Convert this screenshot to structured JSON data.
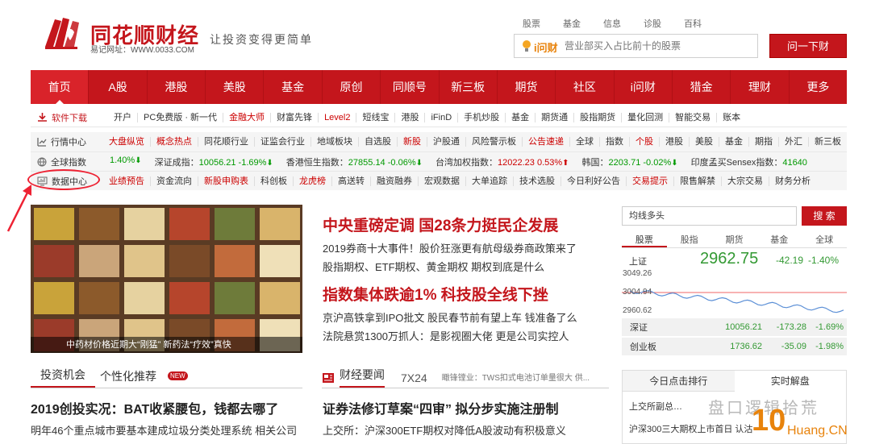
{
  "header": {
    "logo_text": "同花顺财经",
    "logo_url": "易记网址：WWW.0033.COM",
    "slogan": "让投资变得更简单",
    "search_tabs": [
      "股票",
      "基金",
      "信息",
      "诊股",
      "百科"
    ],
    "search_brand": "i问财",
    "search_placeholder": "营业部买入占比前十的股票",
    "ask_button": "问一下财"
  },
  "main_nav": [
    "首页",
    "A股",
    "港股",
    "美股",
    "基金",
    "原创",
    "同顺号",
    "新三板",
    "期货",
    "社区",
    "i问财",
    "猎金",
    "理财",
    "更多"
  ],
  "software_row": {
    "label": "软件下载",
    "items": [
      {
        "t": "开户",
        "hot": false
      },
      {
        "t": "PC免费版 · 新一代",
        "hot": false
      },
      {
        "t": "金融大师",
        "hot": true
      },
      {
        "t": "财富先锋",
        "hot": false
      },
      {
        "t": "Level2",
        "hot": true
      },
      {
        "t": "短线宝",
        "hot": false
      },
      {
        "t": "港股",
        "hot": false
      },
      {
        "t": "iFinD",
        "hot": false
      },
      {
        "t": "手机炒股",
        "hot": false
      },
      {
        "t": "基金",
        "hot": false
      },
      {
        "t": "期货通",
        "hot": false
      },
      {
        "t": "股指期货",
        "hot": false
      },
      {
        "t": "量化回测",
        "hot": false
      },
      {
        "t": "智能交易",
        "hot": false
      },
      {
        "t": "账本",
        "hot": false
      }
    ]
  },
  "news_row": {
    "label": "行情中心",
    "items": [
      {
        "t": "大盘纵览",
        "hot": true
      },
      {
        "t": "概念热点",
        "hot": true
      },
      {
        "t": "同花顺行业",
        "hot": false
      },
      {
        "t": "证监会行业",
        "hot": false
      },
      {
        "t": "地域板块",
        "hot": false
      },
      {
        "t": "自选股",
        "hot": false
      },
      {
        "t": "新股",
        "hot": true
      },
      {
        "t": "沪股通",
        "hot": false
      },
      {
        "t": "风险警示板",
        "hot": false
      },
      {
        "t": "公告速递",
        "hot": true
      },
      {
        "t": "全球",
        "hot": false
      },
      {
        "t": "指数",
        "hot": false
      },
      {
        "t": "个股",
        "hot": true
      },
      {
        "t": "港股",
        "hot": false
      },
      {
        "t": "美股",
        "hot": false
      },
      {
        "t": "基金",
        "hot": false
      },
      {
        "t": "期指",
        "hot": false
      },
      {
        "t": "外汇",
        "hot": false
      },
      {
        "t": "新三板",
        "hot": false
      }
    ]
  },
  "index_row": {
    "label": "全球指数",
    "items": [
      {
        "name": "",
        "val": "1.40%",
        "dir": "down",
        "cls": "v"
      },
      {
        "name": "深证成指：",
        "val": "10056.21",
        "chg": "-1.69%",
        "dir": "down"
      },
      {
        "name": "香港恒生指数：",
        "val": "27855.14",
        "chg": "-0.06%",
        "dir": "down"
      },
      {
        "name": "台湾加权指数：",
        "val": "12022.23",
        "chg": "0.53%",
        "dir": "up"
      },
      {
        "name": "韩国：",
        "val": "2203.71",
        "chg": "-0.02%",
        "dir": "down"
      },
      {
        "name": "印度孟买Sensex指数：",
        "val": "41640",
        "chg": "",
        "dir": ""
      }
    ]
  },
  "data_row": {
    "label": "数据中心",
    "items": [
      {
        "t": "业绩预告",
        "hot": true
      },
      {
        "t": "资金流向",
        "hot": false
      },
      {
        "t": "新股申购表",
        "hot": true
      },
      {
        "t": "科创板",
        "hot": false
      },
      {
        "t": "龙虎榜",
        "hot": true
      },
      {
        "t": "高送转",
        "hot": false
      },
      {
        "t": "融资融券",
        "hot": false
      },
      {
        "t": "宏观数据",
        "hot": false
      },
      {
        "t": "大单追踪",
        "hot": false
      },
      {
        "t": "技术选股",
        "hot": false
      },
      {
        "t": "今日利好公告",
        "hot": false
      },
      {
        "t": "交易提示",
        "hot": true
      },
      {
        "t": "限售解禁",
        "hot": false
      },
      {
        "t": "大宗交易",
        "hot": false
      },
      {
        "t": "财务分析",
        "hot": false
      }
    ]
  },
  "photo": {
    "caption": "中药材价格近期大“刚猛”  新药法“疗效”真快"
  },
  "headlines": {
    "h1": "中央重磅定调 国28条力挺民企发展",
    "s1": "2019券商十大事件！股价狂涨更有航母级券商政策来了",
    "s2": "股指期权、ETF期权、黄金期权 期权到底是什么",
    "h2": "指数集体跌逾1% 科技股全线下挫",
    "s3": "京沪高铁拿到IPO批文 股民春节前有望上车 钱准备了么",
    "s4": "法院悬赏1300万抓人：是影视圈大佬 更是公司实控人"
  },
  "stock": {
    "search_text": "均线多头",
    "search_btn": "搜 索",
    "tabs": [
      "股票",
      "股指",
      "期货",
      "基金",
      "全球"
    ],
    "sh_name": "上证",
    "sh_price": "2962.75",
    "sh_chg": "-42.19",
    "sh_pct": "-1.40%",
    "y_top": "3049.26",
    "y_mid": "3004.94",
    "y_bot": "2960.62",
    "sz": {
      "name": "深证",
      "price": "10056.21",
      "chg": "-173.28",
      "pct": "-1.69%"
    },
    "cy": {
      "name": "创业板",
      "price": "1736.62",
      "chg": "-35.09",
      "pct": "-1.98%"
    }
  },
  "sections": {
    "left_tab_a": "投资机会",
    "left_tab_b": "个性化推荐",
    "new_badge": "NEW",
    "left_title": "2019创投实况：BAT收紧腰包，钱都去哪了",
    "left_sub": "明年46个重点城市要基本建成垃圾分类处理系统 相关公司",
    "mid_tab_a": "财经要闻",
    "mid_tab_b": "7X24",
    "mid_ticker": "瞰锋镗业：TWS扣式电池订单量很大 供...",
    "mid_title": "证券法修订草案“四审” 拟分步实施注册制",
    "mid_sub": "上交所：沪深300ETF期权对降低A股波动有积极意义",
    "rank_tab_a": "今日点击排行",
    "rank_tab_b": "实时解盘",
    "rank_item1": "上交所副总…",
    "rank_item2": "沪深300三大期权上市首日 认沽",
    "watermark": "盘口逻辑拾荒",
    "watermark2": "Huang.CN"
  },
  "colors": {
    "brand_red": "#c4161c",
    "down_green": "#339933"
  }
}
